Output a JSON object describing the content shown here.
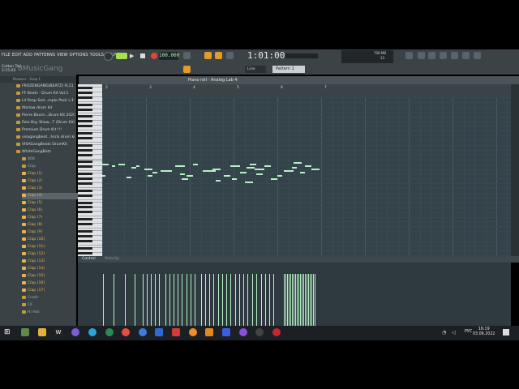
{
  "menu": [
    "FILE",
    "EDIT",
    "ADD",
    "PATTERNS",
    "VIEW",
    "OPTIONS",
    "TOOLS",
    "HELP"
  ],
  "project": {
    "name": "Cotton Tail",
    "time": "2:15:03"
  },
  "watermark": "8MusicGang",
  "tempo": "100.000",
  "time_display": "1:01:00",
  "cpu": {
    "mem": "708 MB",
    "val": "13"
  },
  "pattern": "Pattern 1",
  "snap": "Line",
  "browser": {
    "header": "Browser - Snap 1",
    "items": [
      {
        "type": "folder",
        "label": "FROZENGANG(BEATZ) FL11"
      },
      {
        "type": "folder",
        "label": "FF Beats - Drum Kit Vol.1"
      },
      {
        "type": "folder",
        "label": "Lil Peep Sad...mple Pack v.1"
      },
      {
        "type": "folder",
        "label": "Marlow drum kit"
      },
      {
        "type": "folder",
        "label": "Pierre Bourn...Drum Kit 2020"
      },
      {
        "type": "folder",
        "label": "Polo Boy Shaw...T (Drum Kit)"
      },
      {
        "type": "folder",
        "label": "Premium Drum Kit !!!"
      },
      {
        "type": "folder",
        "label": "visagangbeat...hsrls drum kit"
      },
      {
        "type": "folder",
        "label": "VISAGangBeats DrumKit"
      },
      {
        "type": "folder",
        "label": "WhiteGangBetz"
      },
      {
        "type": "sub",
        "label": "808"
      },
      {
        "type": "sub",
        "label": "Clap"
      },
      {
        "type": "clip",
        "label": "Clap (1)"
      },
      {
        "type": "clip",
        "label": "Clap (2)"
      },
      {
        "type": "clip",
        "label": "Clap (3)"
      },
      {
        "type": "clip",
        "label": "Clap (4)",
        "selected": true
      },
      {
        "type": "clip",
        "label": "Clap (5)"
      },
      {
        "type": "clip",
        "label": "Clap (6)"
      },
      {
        "type": "clip",
        "label": "Clap (7)"
      },
      {
        "type": "clip",
        "label": "Clap (8)"
      },
      {
        "type": "clip",
        "label": "Clap (9)"
      },
      {
        "type": "clip",
        "label": "Clap (10)"
      },
      {
        "type": "clip",
        "label": "Clap (11)"
      },
      {
        "type": "clip",
        "label": "Clap (12)"
      },
      {
        "type": "clip",
        "label": "Clap (13)"
      },
      {
        "type": "clip",
        "label": "Clap (14)"
      },
      {
        "type": "clip",
        "label": "Clap (15)"
      },
      {
        "type": "clip",
        "label": "Clap (16)"
      },
      {
        "type": "clip",
        "label": "Clap (17)"
      },
      {
        "type": "sub",
        "label": "Crash"
      },
      {
        "type": "sub",
        "label": "FX"
      },
      {
        "type": "sub",
        "label": "Hi Hat"
      }
    ]
  },
  "piano_roll": {
    "title": "Piano roll - Analog Lab 4",
    "bars": [
      "2",
      "3",
      "4",
      "5",
      "6",
      "7"
    ],
    "control_label": "Control",
    "velocity_label": "Velocity"
  },
  "taskbar": {
    "lang": "РУС",
    "time": "16:19",
    "date": "03.06.2022"
  },
  "colors": {
    "accent": "#e59a2a",
    "note": "#b6f0c4",
    "grid": "#34424a"
  }
}
